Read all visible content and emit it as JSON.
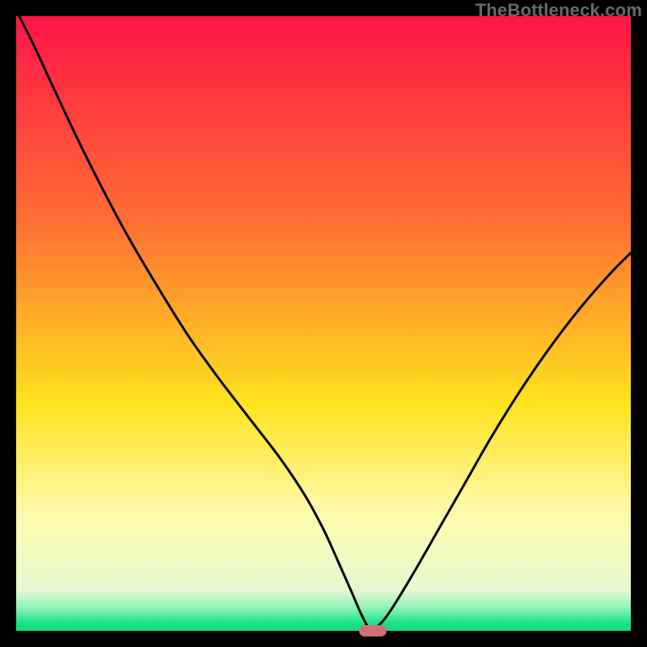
{
  "watermark": "TheBottleneck.com",
  "chart_data": {
    "type": "line",
    "title": "",
    "xlabel": "",
    "ylabel": "",
    "xlim": [
      0,
      100
    ],
    "ylim": [
      0,
      100
    ],
    "grid": false,
    "legend": false,
    "gradient_stops": [
      {
        "pct": 0,
        "color": "#ff1547"
      },
      {
        "pct": 34,
        "color": "#ff7033"
      },
      {
        "pct": 63,
        "color": "#ffe31e"
      },
      {
        "pct": 81,
        "color": "#fffaac"
      },
      {
        "pct": 93.5,
        "color": "#e4f9d1"
      },
      {
        "pct": 96.3,
        "color": "#8cf2b6"
      },
      {
        "pct": 98.6,
        "color": "#1fe48d"
      },
      {
        "pct": 100,
        "color": "#18d984"
      }
    ],
    "series": [
      {
        "name": "bottleneck-curve",
        "color": "#000000",
        "x": [
          0.5,
          3,
          6,
          10,
          14,
          18,
          23,
          28,
          33,
          38,
          43,
          47,
          50,
          52.5,
          54.5,
          56,
          57,
          57.5,
          58.5,
          60,
          62,
          65,
          69,
          73,
          77,
          81,
          85,
          89,
          93,
          97,
          100
        ],
        "y": [
          100,
          95,
          88.5,
          80,
          72,
          64.5,
          56,
          48,
          41,
          34.5,
          28,
          22,
          16.5,
          11,
          6.5,
          3,
          1,
          0,
          0.5,
          2,
          5,
          10,
          17,
          24,
          31,
          37.5,
          43.5,
          49,
          54,
          58.5,
          61.5
        ]
      }
    ],
    "marker": {
      "x_center": 58,
      "y": 0,
      "width": 4.5
    }
  }
}
